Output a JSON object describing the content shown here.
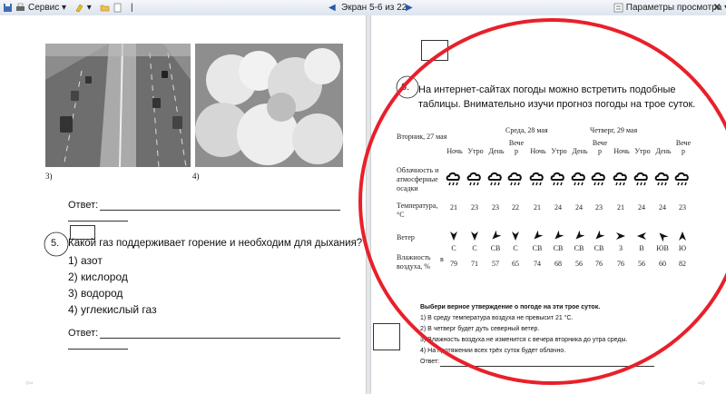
{
  "toolbar": {
    "service_label": "Сервис",
    "screen_label": "Экран 5-6 из 22",
    "view_params_label": "Параметры просмотра",
    "icons": [
      "save-icon",
      "print-icon",
      "highlight-icon",
      "folder-icon",
      "page-icon",
      "prev-screen-icon",
      "next-screen-icon",
      "settings-icon",
      "close-icon"
    ]
  },
  "left_page": {
    "caption_left": "3)",
    "caption_right": "4)",
    "answer1_label": "Ответ:",
    "q5_number": "5.",
    "q5_text": "Какой газ поддерживает горение и необходим для дыхания?",
    "q5_options": [
      "1) азот",
      "2) кислород",
      "3) водород",
      "4) углекислый газ"
    ],
    "answer2_label": "Ответ:"
  },
  "right_page": {
    "q6_number": "6.",
    "q6_line1": "На интернет-сайтах погоды можно встретить подобные",
    "q6_line2": "таблицы. Внимательно изучи прогноз погоды на трое суток.",
    "days": [
      "Вторник, 27 мая",
      "Среда, 28 мая",
      "Четверг, 29 мая"
    ],
    "periods": [
      "Ночь",
      "Утро",
      "День",
      "Вече р",
      "Ночь",
      "Утро",
      "День",
      "Вече р",
      "Ночь",
      "Утро",
      "День",
      "Вече р"
    ],
    "row_labels": {
      "clouds": "Облачность и атмосферные осадки",
      "temperature": "Температура, °С",
      "wind": "Ветер",
      "humidity": "Влажность воздуха, %"
    },
    "humidity_marker": "в",
    "temperatures": [
      "21",
      "23",
      "23",
      "22",
      "21",
      "24",
      "24",
      "23",
      "21",
      "24",
      "24",
      "23"
    ],
    "wind_directions": [
      "С",
      "С",
      "СВ",
      "С",
      "СВ",
      "СВ",
      "СВ",
      "СВ",
      "З",
      "В",
      "ЮВ",
      "Ю"
    ],
    "humidity": [
      "79",
      "71",
      "57",
      "65",
      "74",
      "68",
      "56",
      "76",
      "76",
      "56",
      "60",
      "82"
    ],
    "task_title": "Выбери верное утверждение о погоде на эти трое суток.",
    "task_options": [
      "1) В среду температура воздуха не превысит 21 °С.",
      "2) В четверг будет дуть северный ветер.",
      "3) Влажность воздуха не изменится с вечера вторника до утра среды.",
      "4) На протяжении всех трёх суток будет облачно."
    ],
    "answer_label": "Ответ:"
  },
  "annotation_color": "#e8202a"
}
